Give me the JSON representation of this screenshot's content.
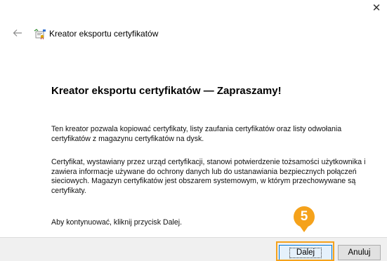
{
  "window": {
    "close_glyph": "✕"
  },
  "nav": {
    "back_icon": "back-arrow-icon",
    "wizard_icon": "certificate-wizard-icon",
    "title": "Kreator eksportu certyfikatów"
  },
  "main": {
    "heading": "Kreator eksportu certyfikatów — Zapraszamy!",
    "paragraphs": [
      "Ten kreator pozwala kopiować certyfikaty, listy zaufania certyfikatów oraz listy odwołania certyfikatów z magazynu certyfikatów na dysk.",
      "Certyfikat, wystawiany przez urząd certyfikacji, stanowi potwierdzenie tożsamości użytkownika i zawiera informacje używane do ochrony danych lub do ustanawiania bezpiecznych połączeń sieciowych. Magazyn certyfikatów jest obszarem systemowym, w którym przechowywane są certyfikaty.",
      "Aby kontynuować, kliknij przycisk Dalej."
    ]
  },
  "footer": {
    "next_label": "Dalej",
    "cancel_label": "Anuluj"
  },
  "annotation": {
    "step_number": "5",
    "color": "#f5a21b"
  }
}
